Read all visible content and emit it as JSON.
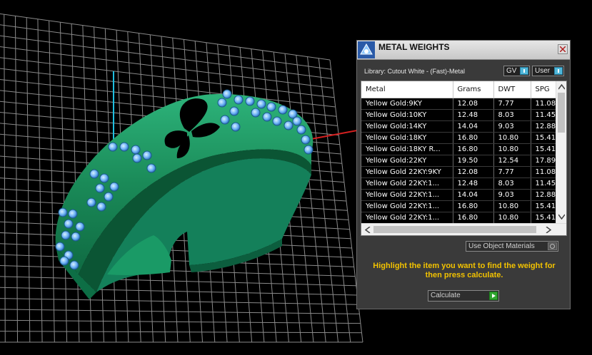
{
  "panel": {
    "title": "METAL WEIGHTS",
    "library_label": "Library: Cutout White - (Fast)-Metal",
    "gv_label": "GV",
    "user_label": "User",
    "table": {
      "columns": [
        "Metal",
        "Grams",
        "DWT",
        "SPG"
      ],
      "rows": [
        [
          "Yellow Gold:9KY",
          "12.08",
          "7.77",
          "11.08"
        ],
        [
          "Yellow Gold:10KY",
          "12.48",
          "8.03",
          "11.45"
        ],
        [
          "Yellow Gold:14KY",
          "14.04",
          "9.03",
          "12.88"
        ],
        [
          "Yellow Gold:18KY",
          "16.80",
          "10.80",
          "15.41"
        ],
        [
          "Yellow Gold:18KY R...",
          "16.80",
          "10.80",
          "15.41"
        ],
        [
          "Yellow Gold:22KY",
          "19.50",
          "12.54",
          "17.89"
        ],
        [
          "Yellow Gold 22KY:9KY",
          "12.08",
          "7.77",
          "11.08"
        ],
        [
          "Yellow Gold 22KY:1...",
          "12.48",
          "8.03",
          "11.45"
        ],
        [
          "Yellow Gold 22KY:1...",
          "14.04",
          "9.03",
          "12.88"
        ],
        [
          "Yellow Gold 22KY:1...",
          "16.80",
          "10.80",
          "15.41"
        ],
        [
          "Yellow Gold 22KY:1...",
          "16.80",
          "10.80",
          "15.41"
        ]
      ]
    },
    "material_source": "Use Object Materials",
    "hint": "Highlight the item you want to find the weight for then press calculate.",
    "calculate_label": "Calculate"
  },
  "colors": {
    "viewport_bg": "#000000",
    "grid": "#8a8a8a",
    "ring": "#1f8f5e",
    "gems": "#7fc0ff",
    "hint_text": "#f2c200",
    "toggle_accent": "#4fb7d9",
    "go_button": "#2fa52f"
  },
  "icons": {
    "app_logo": "rhino-logo-icon",
    "close": "close-icon",
    "dropdown": "chevron-down-icon",
    "calculate": "play-icon"
  }
}
